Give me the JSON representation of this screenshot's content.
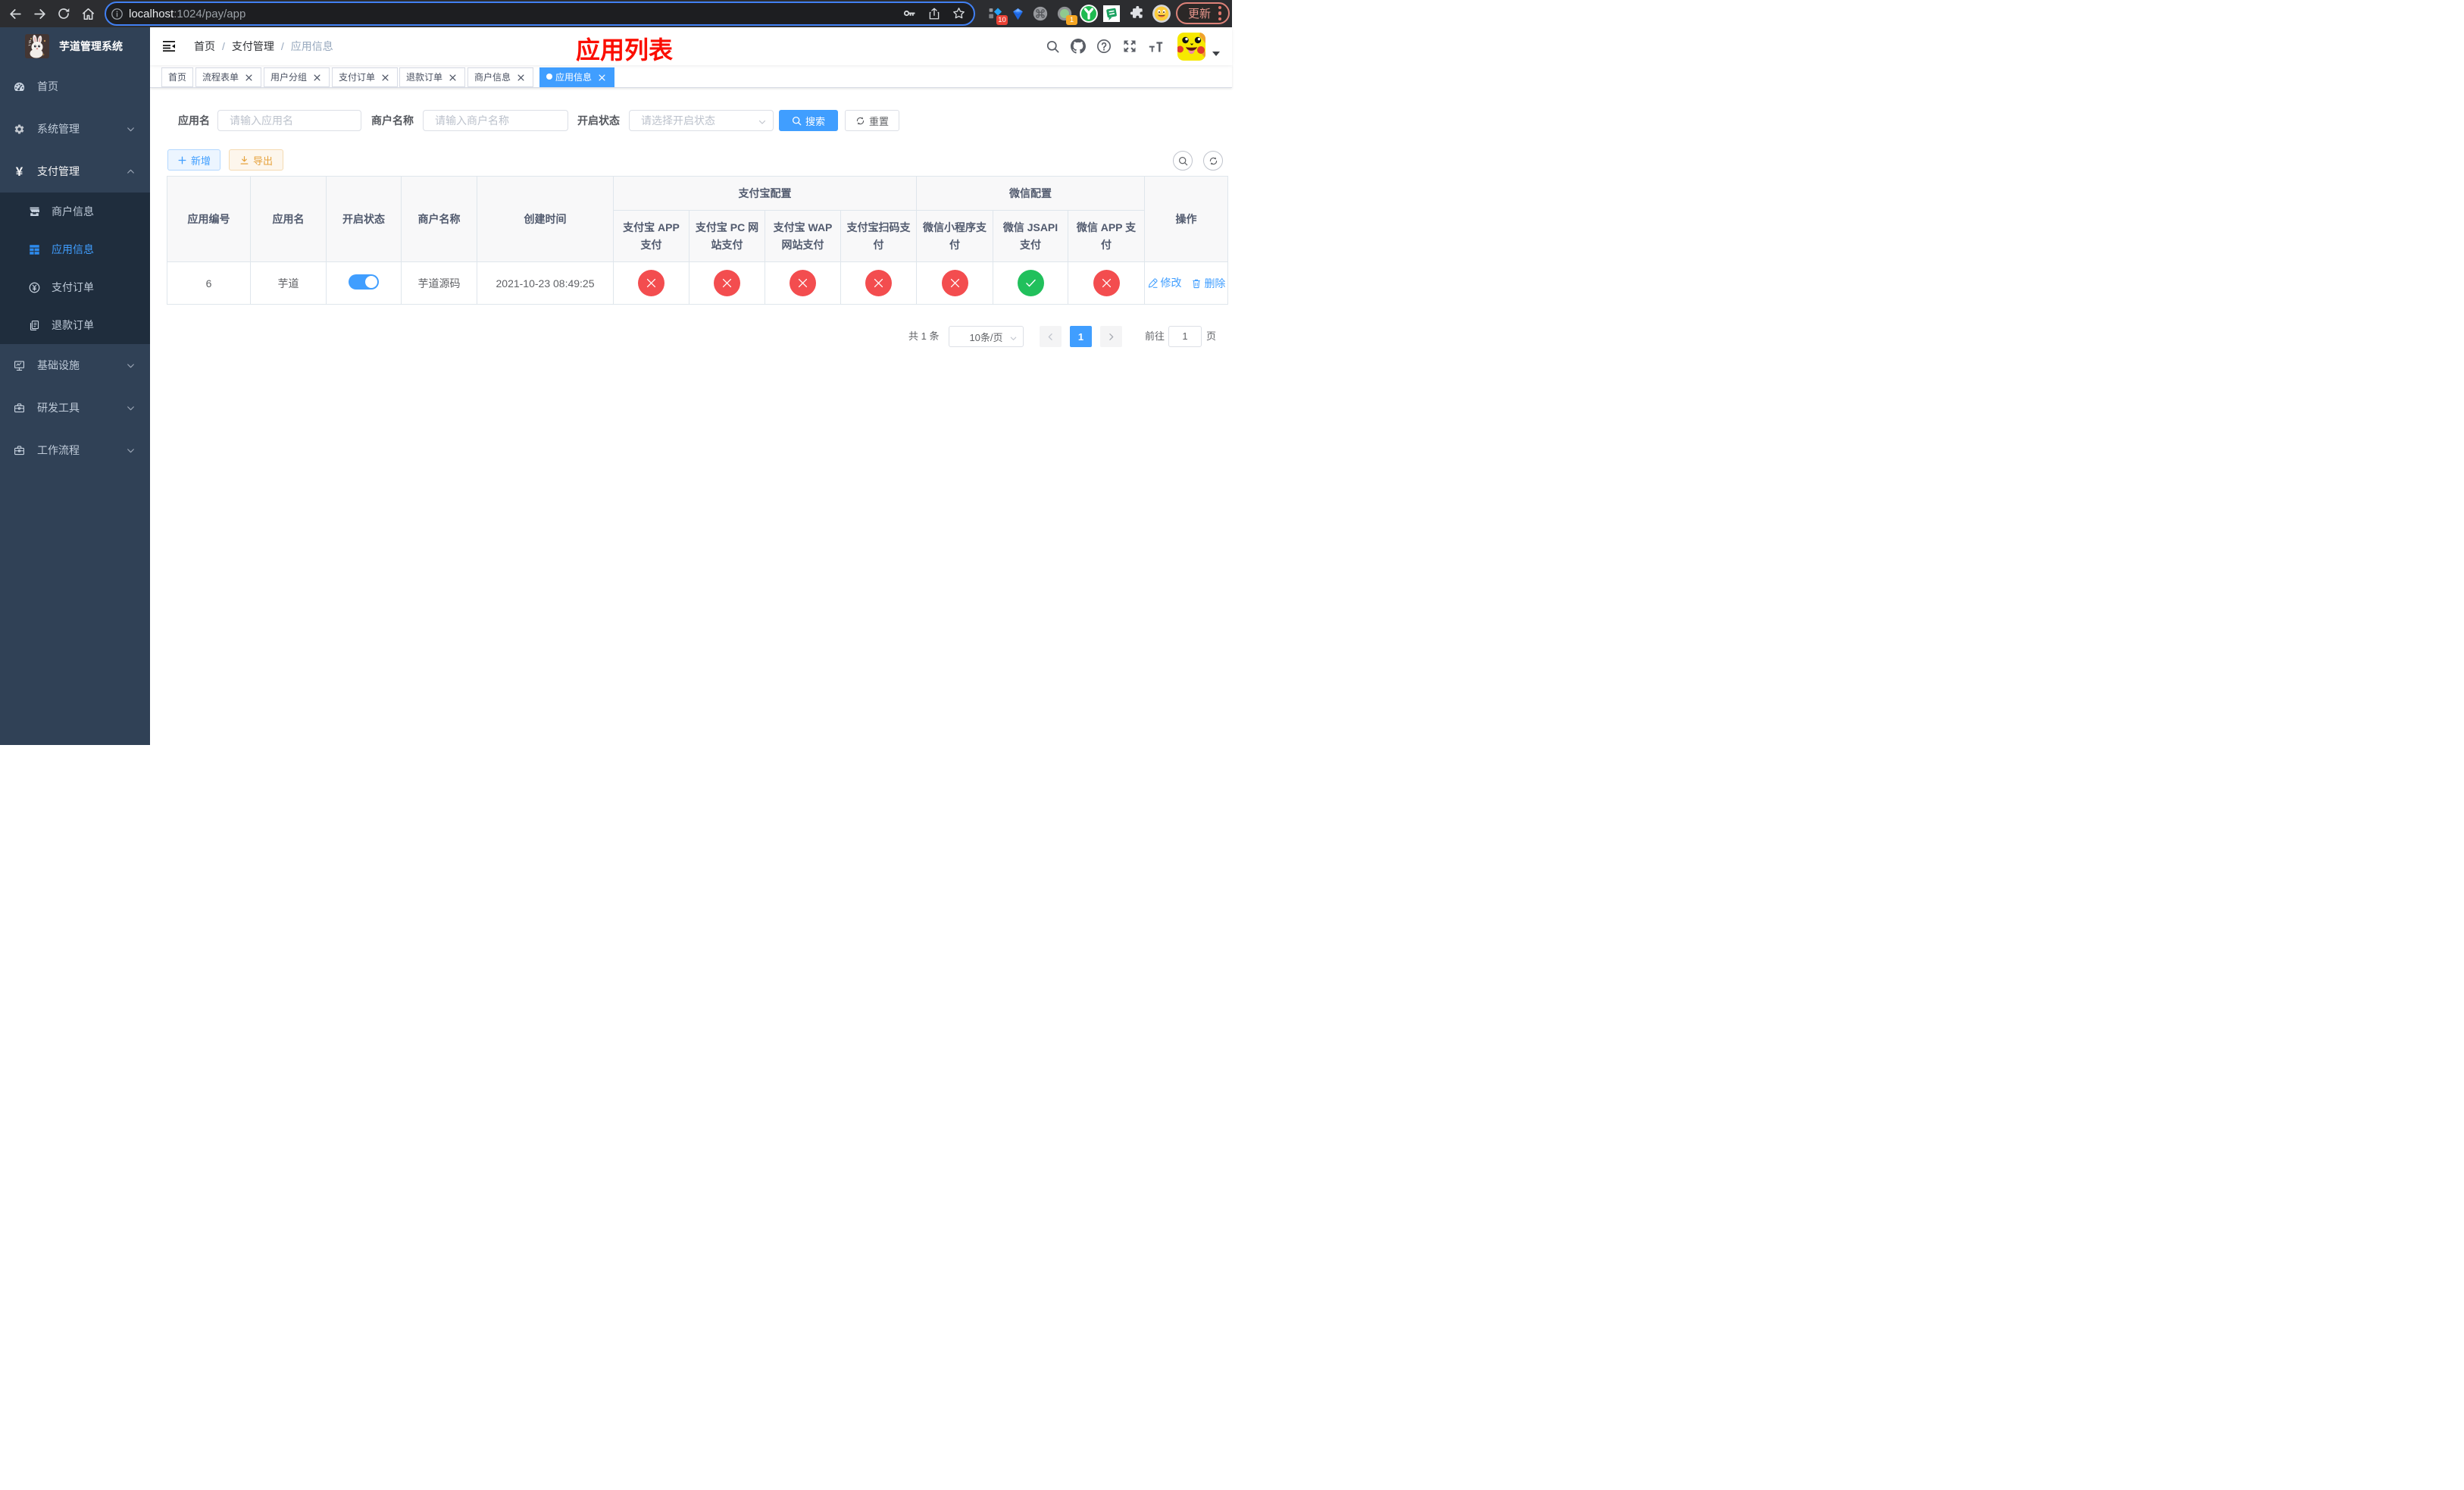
{
  "browser": {
    "url_host": "localhost",
    "url_path": ":1024/pay/app",
    "update_label": "更新",
    "ext_badge_blocker": "10",
    "ext_badge_proxy": "1"
  },
  "sidebar": {
    "title": "芋道管理系统",
    "items": {
      "home": "首页",
      "system": "系统管理",
      "pay": "支付管理",
      "merchant": "商户信息",
      "app": "应用信息",
      "order": "支付订单",
      "refund": "退款订单",
      "infra": "基础设施",
      "dev": "研发工具",
      "flow": "工作流程"
    }
  },
  "header": {
    "breadcrumb": {
      "home": "首页",
      "section": "支付管理",
      "current": "应用信息"
    },
    "annotation": "应用列表"
  },
  "tags": {
    "t0": "首页",
    "t1": "流程表单",
    "t2": "用户分组",
    "t3": "支付订单",
    "t4": "退款订单",
    "t5": "商户信息",
    "t6": "应用信息"
  },
  "search": {
    "app_label": "应用名",
    "app_placeholder": "请输入应用名",
    "merchant_label": "商户名称",
    "merchant_placeholder": "请输入商户名称",
    "status_label": "开启状态",
    "status_placeholder": "请选择开启状态",
    "search_label": "搜索",
    "reset_label": "重置"
  },
  "toolbar": {
    "add_label": "新增",
    "export_label": "导出"
  },
  "table": {
    "groups": {
      "alipay": "支付宝配置",
      "wechat": "微信配置"
    },
    "headers": {
      "id": "应用编号",
      "name": "应用名",
      "status": "开启状态",
      "merchant": "商户名称",
      "created": "创建时间",
      "alipay_app": "支付宝 APP 支付",
      "alipay_pc": "支付宝 PC 网站支付",
      "alipay_wap": "支付宝 WAP 网站支付",
      "alipay_qr": "支付宝扫码支付",
      "wx_mini": "微信小程序支付",
      "wx_jsapi": "微信 JSAPI 支付",
      "wx_app": "微信 APP 支付",
      "actions": "操作"
    },
    "row": {
      "id": "6",
      "name": "芋道",
      "switch_on": true,
      "merchant": "芋道源码",
      "created": "2021-10-23 08:49:25",
      "alipay_app": "disabled",
      "alipay_pc": "disabled",
      "alipay_wap": "disabled",
      "alipay_qr": "disabled",
      "wx_mini": "disabled",
      "wx_jsapi": "enabled",
      "wx_app": "disabled",
      "edit_label": "修改",
      "delete_label": "删除"
    }
  },
  "pagination": {
    "total": "共 1 条",
    "page_size": "10条/页",
    "current_page": "1",
    "goto_label": "前往",
    "goto_value": "1",
    "unit_label": "页"
  },
  "colors": {
    "accent": "#409eff",
    "danger": "#f34d4f",
    "success": "#1fc16b",
    "sidebar_bg": "#304156",
    "submenu_bg": "#1f2d3d",
    "annotation": "#fb0e01"
  }
}
